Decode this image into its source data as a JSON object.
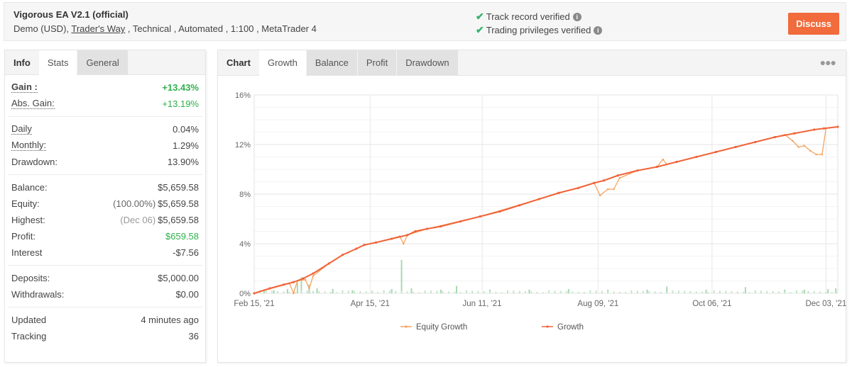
{
  "header": {
    "title": "Vigorous EA V2.1 (official)",
    "sub_prefix": "Demo (USD), ",
    "broker": "Trader's Way",
    "sub_suffix": " , Technical , Automated , 1:100 , MetaTrader 4",
    "verifications": [
      {
        "label": "Track record verified",
        "icon": "check-icon"
      },
      {
        "label": "Trading privileges verified",
        "icon": "check-icon"
      }
    ],
    "discuss_label": "Discuss",
    "accent": "#f26b3c"
  },
  "stats_panel": {
    "tabs": [
      {
        "label": "Info",
        "state": "header"
      },
      {
        "label": "Stats",
        "state": "active"
      },
      {
        "label": "General",
        "state": "inactive"
      }
    ],
    "groups": [
      [
        {
          "label": "Gain :",
          "value": "+13.43%",
          "color": "green"
        },
        {
          "label": "Abs. Gain:",
          "value": "+13.19%",
          "color": "green"
        }
      ],
      [
        {
          "label": "Daily",
          "value": "0.04%"
        },
        {
          "label": "Monthly:",
          "value": "1.29%"
        },
        {
          "label": "Drawdown:",
          "value": "13.90%"
        }
      ],
      [
        {
          "label": "Balance:",
          "value": "$5,659.58"
        },
        {
          "label": "Equity:",
          "note": "(100.00%)",
          "value": "$5,659.58"
        },
        {
          "label": "Highest:",
          "note": "(Dec 06)",
          "value": "$5,659.58"
        },
        {
          "label": "Profit:",
          "value": "$659.58",
          "color": "green"
        },
        {
          "label": "Interest",
          "value": "-$7.56"
        }
      ],
      [
        {
          "label": "Deposits:",
          "value": "$5,000.00"
        },
        {
          "label": "Withdrawals:",
          "value": "$0.00"
        }
      ],
      [
        {
          "label": "Updated",
          "value": "4 minutes ago"
        },
        {
          "label": "Tracking",
          "value": "36"
        }
      ]
    ]
  },
  "chart_panel": {
    "tabs": [
      {
        "label": "Chart",
        "state": "header"
      },
      {
        "label": "Growth",
        "state": "active"
      },
      {
        "label": "Balance",
        "state": "inactive"
      },
      {
        "label": "Profit",
        "state": "inactive"
      },
      {
        "label": "Drawdown",
        "state": "inactive"
      }
    ],
    "menu_icon": "more-dots-icon"
  },
  "chart_data": {
    "type": "line",
    "title": "",
    "xlabel": "",
    "ylabel": "",
    "ylim": [
      0,
      16
    ],
    "y_ticks": [
      "0%",
      "4%",
      "8%",
      "12%",
      "16%"
    ],
    "y_tick_values": [
      0,
      4,
      8,
      12,
      16
    ],
    "x_ticks": [
      "Feb 15, '21",
      "Apr 15, '21",
      "Jun 11, '21",
      "Aug 09, '21",
      "Oct 06, '21",
      "Dec 03, '21"
    ],
    "x_range_days": [
      0,
      297
    ],
    "x_tick_days": [
      0,
      59,
      116,
      175,
      233,
      291
    ],
    "grid": true,
    "legend": [
      {
        "name": "Equity Growth",
        "color": "#f4a460"
      },
      {
        "name": "Growth",
        "color": "#f0643a"
      }
    ],
    "legend_position": "bottom",
    "series": [
      {
        "name": "Growth",
        "color": "#f0643a",
        "points": [
          [
            0,
            0
          ],
          [
            8,
            0.4
          ],
          [
            15,
            0.7
          ],
          [
            20,
            0.9
          ],
          [
            25,
            1.2
          ],
          [
            30,
            1.6
          ],
          [
            38,
            2.4
          ],
          [
            45,
            3.1
          ],
          [
            52,
            3.6
          ],
          [
            56,
            3.9
          ],
          [
            62,
            4.1
          ],
          [
            70,
            4.4
          ],
          [
            78,
            4.7
          ],
          [
            82,
            5.0
          ],
          [
            88,
            5.2
          ],
          [
            95,
            5.4
          ],
          [
            105,
            5.8
          ],
          [
            115,
            6.2
          ],
          [
            125,
            6.6
          ],
          [
            135,
            7.1
          ],
          [
            145,
            7.6
          ],
          [
            155,
            8.1
          ],
          [
            165,
            8.5
          ],
          [
            173,
            8.9
          ],
          [
            178,
            9.1
          ],
          [
            185,
            9.5
          ],
          [
            195,
            9.9
          ],
          [
            205,
            10.2
          ],
          [
            215,
            10.6
          ],
          [
            225,
            11.0
          ],
          [
            235,
            11.4
          ],
          [
            245,
            11.8
          ],
          [
            255,
            12.2
          ],
          [
            265,
            12.6
          ],
          [
            275,
            12.9
          ],
          [
            285,
            13.2
          ],
          [
            290,
            13.3
          ],
          [
            297,
            13.43
          ]
        ]
      },
      {
        "name": "Equity Growth",
        "color": "#f4a460",
        "points": [
          [
            0,
            0
          ],
          [
            18,
            0.8
          ],
          [
            20,
            0.0
          ],
          [
            22,
            1.0
          ],
          [
            26,
            1.1
          ],
          [
            28,
            0.4
          ],
          [
            30,
            1.4
          ],
          [
            38,
            2.4
          ],
          [
            45,
            3.1
          ],
          [
            48,
            3.3
          ],
          [
            52,
            3.6
          ],
          [
            56,
            3.9
          ],
          [
            62,
            4.1
          ],
          [
            74,
            4.6
          ],
          [
            76,
            4.0
          ],
          [
            78,
            4.7
          ],
          [
            88,
            5.2
          ],
          [
            115,
            6.2
          ],
          [
            145,
            7.6
          ],
          [
            173,
            8.9
          ],
          [
            176,
            7.9
          ],
          [
            180,
            8.4
          ],
          [
            183,
            8.4
          ],
          [
            186,
            9.3
          ],
          [
            195,
            9.9
          ],
          [
            205,
            10.2
          ],
          [
            208,
            10.8
          ],
          [
            210,
            10.4
          ],
          [
            225,
            11.0
          ],
          [
            255,
            12.2
          ],
          [
            270,
            12.8
          ],
          [
            274,
            12.3
          ],
          [
            277,
            11.8
          ],
          [
            280,
            11.9
          ],
          [
            283,
            11.5
          ],
          [
            286,
            11.2
          ],
          [
            289,
            11.2
          ],
          [
            291,
            13.3
          ],
          [
            297,
            13.43
          ]
        ]
      }
    ],
    "bars_note": "small green daily-activity bars along baseline (approx. values)",
    "bars": [
      [
        5,
        0.2
      ],
      [
        10,
        0.25
      ],
      [
        17,
        0.35
      ],
      [
        22,
        0.9
      ],
      [
        24,
        1.3
      ],
      [
        28,
        0.7
      ],
      [
        32,
        0.4
      ],
      [
        40,
        0.35
      ],
      [
        50,
        0.25
      ],
      [
        60,
        0.2
      ],
      [
        70,
        0.35
      ],
      [
        75,
        2.7
      ],
      [
        80,
        0.4
      ],
      [
        95,
        0.3
      ],
      [
        103,
        0.6
      ],
      [
        120,
        0.3
      ],
      [
        140,
        0.3
      ],
      [
        160,
        0.35
      ],
      [
        180,
        0.3
      ],
      [
        200,
        0.3
      ],
      [
        210,
        0.55
      ],
      [
        230,
        0.3
      ],
      [
        250,
        0.5
      ],
      [
        270,
        0.3
      ],
      [
        280,
        0.3
      ],
      [
        292,
        0.35
      ],
      [
        296,
        0.4
      ]
    ]
  }
}
